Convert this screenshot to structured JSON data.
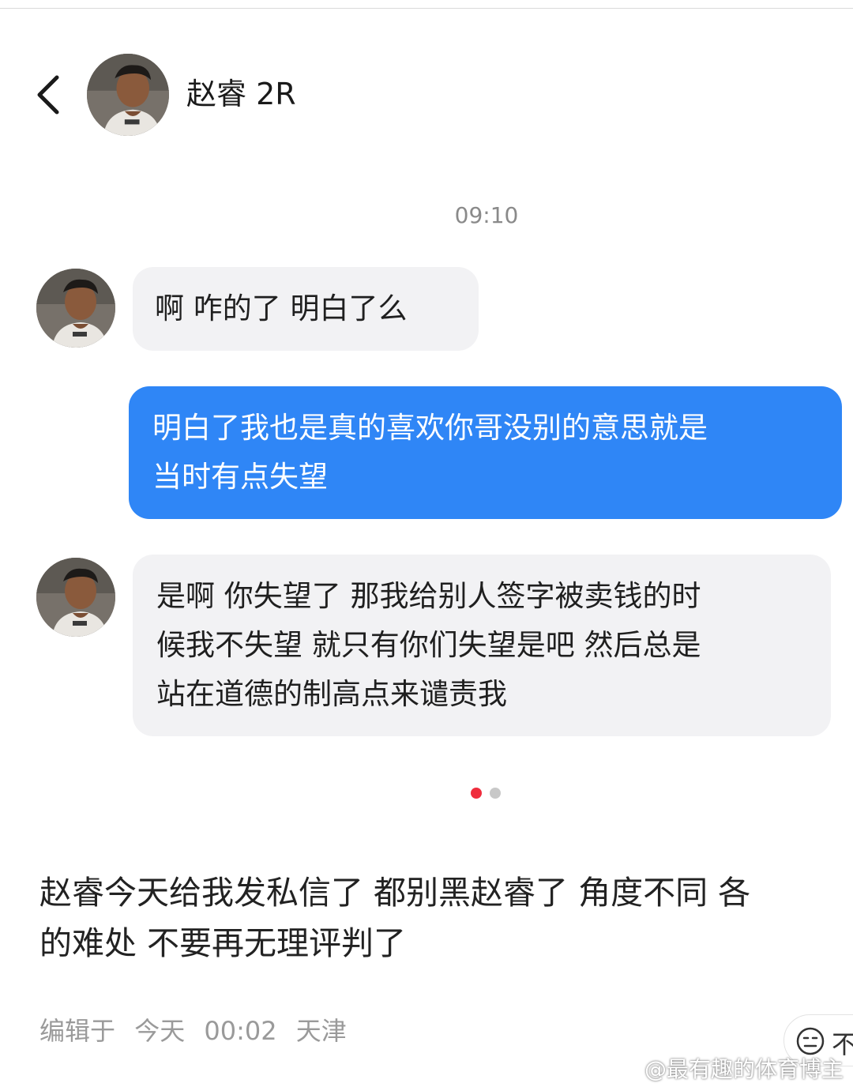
{
  "header": {
    "back_icon": "chevron-left-icon",
    "contact_name": "赵睿 2R"
  },
  "chat": {
    "timestamp": "09:10",
    "messages": [
      {
        "direction": "incoming",
        "text": "啊 咋的了 明白了么"
      },
      {
        "direction": "outgoing",
        "lines": [
          "明白了我也是真的喜欢你哥没别的意思就是",
          "当时有点失望"
        ]
      },
      {
        "direction": "incoming",
        "lines": [
          "是啊 你失望了 那我给别人签字被卖钱的时",
          "候我不失望 就只有你们失望是吧 然后总是",
          "站在道德的制高点来谴责我"
        ]
      }
    ]
  },
  "pager": {
    "current": 1,
    "total": 2,
    "active_color": "#ef2d3d"
  },
  "post": {
    "lines": [
      "赵睿今天给我发私信了 都别黑赵睿了 角度不同 各",
      "的难处 不要再无理评判了"
    ],
    "edit_label": "编辑于",
    "edit_day": "今天",
    "edit_time": "00:02",
    "location": "天津"
  },
  "reaction": {
    "icon": "meh-face-icon",
    "label": "不"
  },
  "watermark": {
    "text": "@最有趣的体育博主",
    "icon": "weibo-logo-icon"
  },
  "colors": {
    "outgoing_bubble": "#2f86f6",
    "incoming_bubble": "#f2f2f4"
  }
}
